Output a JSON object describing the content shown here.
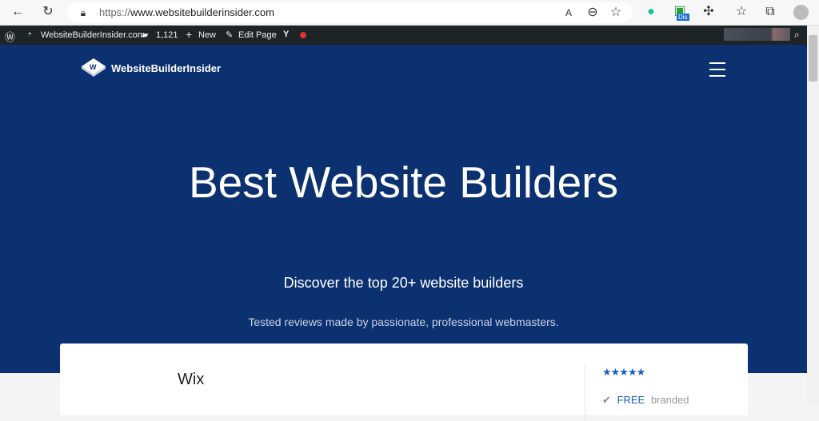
{
  "browser": {
    "url_scheme": "https://",
    "url_host": "www.websitebuilderinsider.com",
    "extension_badge": "Dis"
  },
  "admin_bar": {
    "site": "WebsiteBuilderInsider.com",
    "comments": "1,121",
    "new": "New",
    "edit": "Edit Page"
  },
  "hero": {
    "logo": "WebsiteBuilderInsider",
    "title": "Best Website Builders",
    "subtitle": "Discover the top 20+ website builders",
    "tagline": "Tested reviews made by passionate, professional webmasters."
  },
  "card": {
    "name": "Wix",
    "stars": "★★★★★",
    "plan": "FREE",
    "plan_note": "branded"
  },
  "colors": {
    "hero": "#0c3170",
    "admin": "#1d2327",
    "accent": "#1e5fc4"
  }
}
